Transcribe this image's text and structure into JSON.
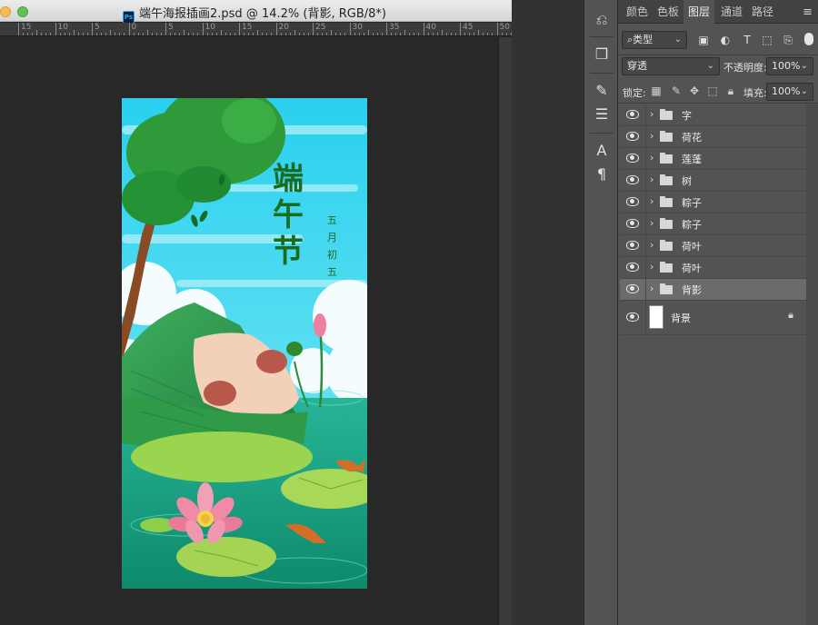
{
  "window": {
    "title": "端午海报插画2.psd @ 14.2% (背影, RGB/8*)",
    "file_badge": "Ps"
  },
  "ruler": {
    "labels": [
      "15",
      "10",
      "5",
      "0",
      "5",
      "10",
      "15",
      "20",
      "25",
      "30",
      "35",
      "40",
      "45",
      "50"
    ]
  },
  "poster": {
    "title_chars": [
      "端",
      "午",
      "节"
    ],
    "date_chars": [
      "五",
      "月",
      "初",
      "五"
    ]
  },
  "tools": [
    "history-icon",
    "3d-icon",
    "brush-settings-icon",
    "adjust-icon",
    "character-icon",
    "paragraph-icon"
  ],
  "panel": {
    "tabs": [
      "颜色",
      "色板",
      "图层",
      "通道",
      "路径"
    ],
    "active_tab": "图层",
    "filter_label": "类型",
    "blend_mode": "穿透",
    "opacity_label": "不透明度:",
    "opacity_value": "100%",
    "lock_label": "锁定:",
    "fill_label": "填充:",
    "fill_value": "100%"
  },
  "layers": [
    {
      "name": "字",
      "type": "group",
      "selected": false
    },
    {
      "name": "荷花",
      "type": "group",
      "selected": false
    },
    {
      "name": "莲蓬",
      "type": "group",
      "selected": false
    },
    {
      "name": "树",
      "type": "group",
      "selected": false
    },
    {
      "name": "粽子",
      "type": "group",
      "selected": false
    },
    {
      "name": "粽子",
      "type": "group",
      "selected": false
    },
    {
      "name": "荷叶",
      "type": "group",
      "selected": false
    },
    {
      "name": "荷叶",
      "type": "group",
      "selected": false
    },
    {
      "name": "背影",
      "type": "group",
      "selected": true
    },
    {
      "name": "背景",
      "type": "background",
      "selected": false
    }
  ],
  "colors": {
    "poster_sky": "#3fd3ec",
    "poster_green": "#1f8f3a",
    "title_green": "#1a6b1e",
    "panel_bg": "#535353"
  }
}
